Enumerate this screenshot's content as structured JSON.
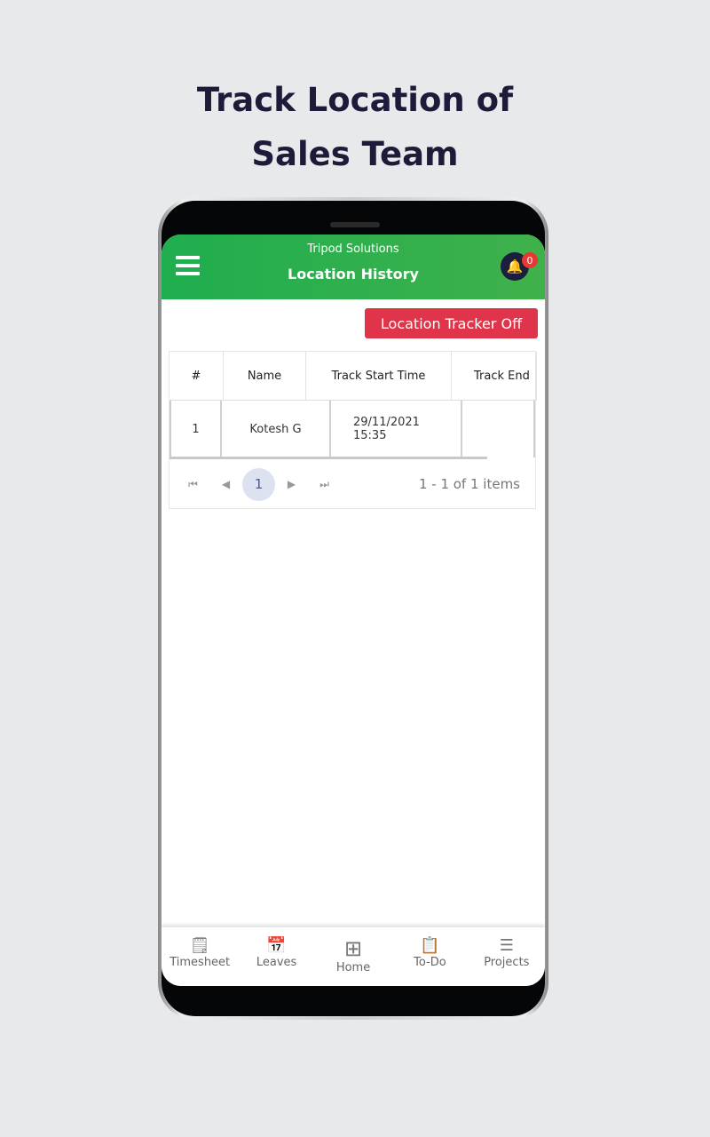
{
  "headline": {
    "line1": "Track Location of",
    "line2": "Sales Team"
  },
  "header": {
    "org": "Tripod Solutions",
    "title": "Location History",
    "notification_count": "0"
  },
  "tracker_button": "Location Tracker Off",
  "table": {
    "columns": [
      "#",
      "Name",
      "Track Start Time",
      "Track End"
    ],
    "rows": [
      {
        "num": "1",
        "name": "Kotesh G",
        "start_date": "29/11/2021",
        "start_time": "15:35",
        "end": ""
      }
    ]
  },
  "pager": {
    "current": "1",
    "info": "1 - 1 of 1 items"
  },
  "nav": [
    {
      "label": "Timesheet",
      "icon": "timesheet-icon"
    },
    {
      "label": "Leaves",
      "icon": "calendar-icon"
    },
    {
      "label": "Home",
      "icon": "grid-icon"
    },
    {
      "label": "To-Do",
      "icon": "clipboard-icon"
    },
    {
      "label": "Projects",
      "icon": "projects-icon"
    }
  ],
  "colors": {
    "header": "#1fae4f",
    "button": "#e0344a",
    "badge": "#e53935"
  }
}
